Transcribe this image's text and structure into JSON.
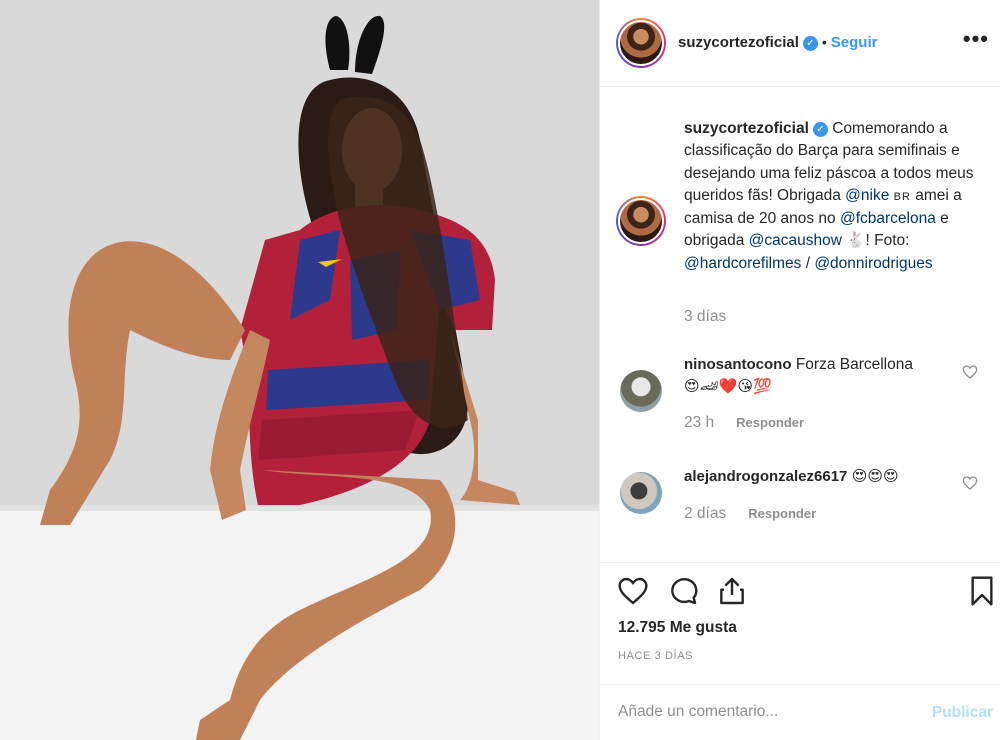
{
  "post": {
    "username": "suzycortezoficial",
    "follow_label": "Seguir",
    "dot": "•",
    "more_label": "•••"
  },
  "caption": {
    "username": "suzycortezoficial",
    "text_1": "Comemorando a classificação do Barça para semifinais e desejando uma feliz páscoa a todos meus queridos fãs! Obrigada",
    "mention_nike": "@nike",
    "br_tag": "BR",
    "text_2": "amei a camisa de 20 anos no",
    "mention_fcb": "@fcbarcelona",
    "text_3": "e obrigada",
    "mention_cacau": "@cacaushow",
    "rabbit_emoji": "🐇",
    "text_4": "! Foto:",
    "mention_hardcore": "@hardcorefilmes",
    "separator": " / ",
    "mention_donni": "@donnirodrigues",
    "time": "3 días"
  },
  "comments": [
    {
      "username": "ninosantocono",
      "text": "Forza Barcellona",
      "emojis": "😍🏎❤️😘💯",
      "time": "23 h",
      "reply_label": "Responder"
    },
    {
      "username": "alejandrogonzalez6617",
      "text": "",
      "emojis": "😍😍😍",
      "time": "2 días",
      "reply_label": "Responder"
    }
  ],
  "footer": {
    "likes": "12.795 Me gusta",
    "ago": "HACE 3 DÍAS",
    "comment_placeholder": "Añade un comentario...",
    "publish_label": "Publicar"
  },
  "colors": {
    "accent_blue": "#3897f0",
    "mention_blue": "#003569",
    "muted": "#8e8e8e",
    "publish_disabled": "#b2dffc"
  }
}
